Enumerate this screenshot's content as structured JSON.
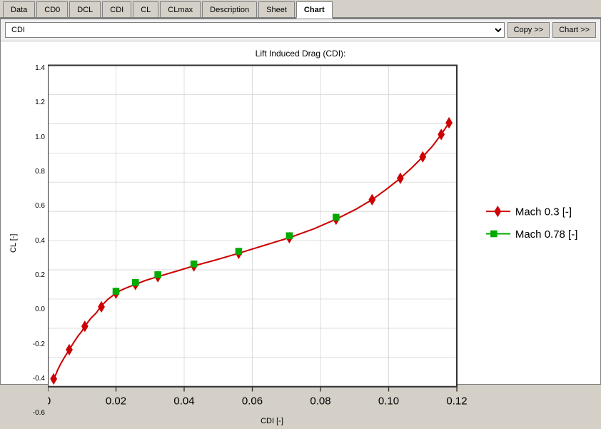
{
  "tabs": [
    {
      "label": "Data",
      "id": "tab-data",
      "active": false
    },
    {
      "label": "CD0",
      "id": "tab-cd0",
      "active": false
    },
    {
      "label": "DCL",
      "id": "tab-dcl",
      "active": false
    },
    {
      "label": "CDI",
      "id": "tab-cdi",
      "active": false
    },
    {
      "label": "CL",
      "id": "tab-cl",
      "active": false
    },
    {
      "label": "CLmax",
      "id": "tab-clmax",
      "active": false
    },
    {
      "label": "Description",
      "id": "tab-description",
      "active": false
    },
    {
      "label": "Sheet",
      "id": "tab-sheet",
      "active": false
    },
    {
      "label": "Chart",
      "id": "tab-chart",
      "active": true
    }
  ],
  "toolbar": {
    "select_value": "CDI",
    "copy_label": "Copy >>",
    "chart_label": "Chart >>"
  },
  "chart": {
    "title": "Lift Induced Drag (CDI):",
    "y_axis_label": "CL [-]",
    "x_axis_label": "CDI [-]",
    "y_ticks": [
      "1.4",
      "1.2",
      "1.0",
      "0.8",
      "0.6",
      "0.4",
      "0.2",
      "0.0",
      "-0.2",
      "-0.4",
      "-0.6"
    ],
    "x_ticks": [
      "0",
      "0.02",
      "0.04",
      "0.06",
      "0.08",
      "0.10",
      "0.12"
    ],
    "legend": [
      {
        "label": "Mach 0.3 [-]",
        "color": "#cc0000",
        "marker": "diamond"
      },
      {
        "label": "Mach 0.78 [-]",
        "color": "#00aa00",
        "marker": "square"
      }
    ]
  }
}
